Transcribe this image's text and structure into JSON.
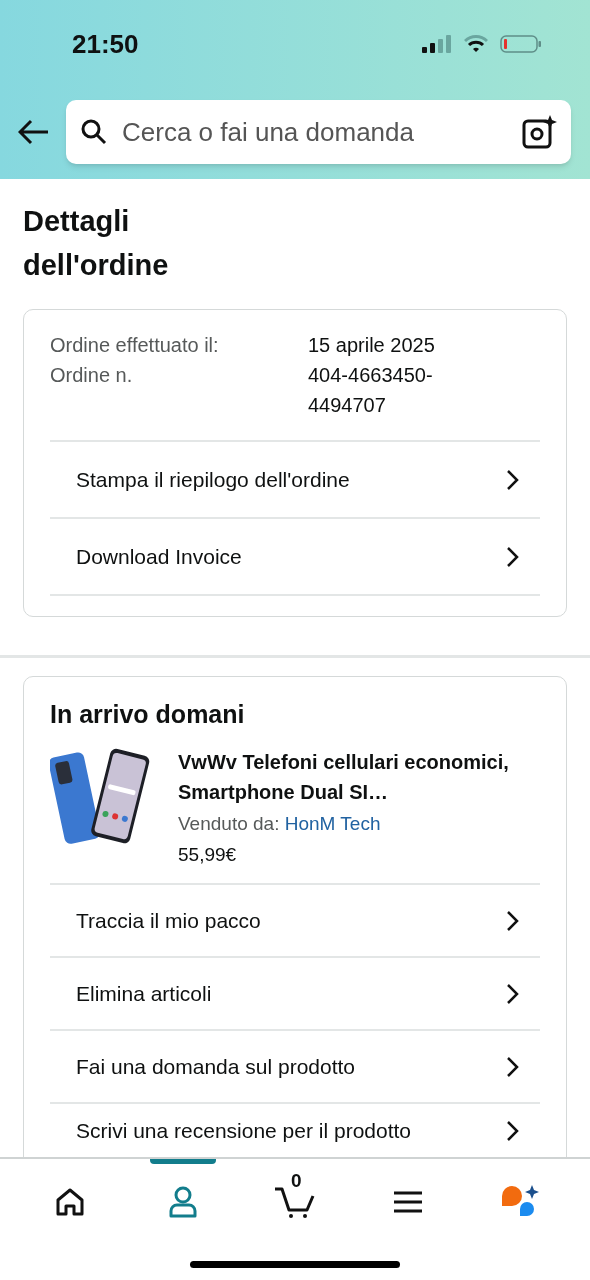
{
  "status_bar": {
    "time": "21:50"
  },
  "search": {
    "placeholder": "Cerca o fai una domanda"
  },
  "title": "Dettagli dell'ordine",
  "order_info": [
    {
      "label": "Ordine effettuato il:",
      "value": "15 aprile 2025"
    },
    {
      "label": "Ordine n.",
      "value": "404-4663450-4494707"
    }
  ],
  "order_links": [
    "Stampa il riepilogo dell'ordine",
    "Download Invoice"
  ],
  "shipment": {
    "heading": "In arrivo domani",
    "product": {
      "title": "VwWv Telefoni cellulari economici, Smartphone Dual SI…",
      "seller_label": "Venduto da:",
      "seller": "HonM Tech",
      "price": "55,99€"
    },
    "actions": [
      "Traccia il mio pacco",
      "Elimina articoli",
      "Fai una domanda sul prodotto",
      "Scrivi una recensione per il prodotto"
    ]
  },
  "nav": {
    "tabs": [
      {
        "kind": "home",
        "selected": false
      },
      {
        "kind": "account",
        "selected": true
      },
      {
        "kind": "cart",
        "selected": false,
        "count": "0"
      },
      {
        "kind": "menu",
        "selected": false
      },
      {
        "kind": "assistant",
        "selected": false
      }
    ]
  }
}
